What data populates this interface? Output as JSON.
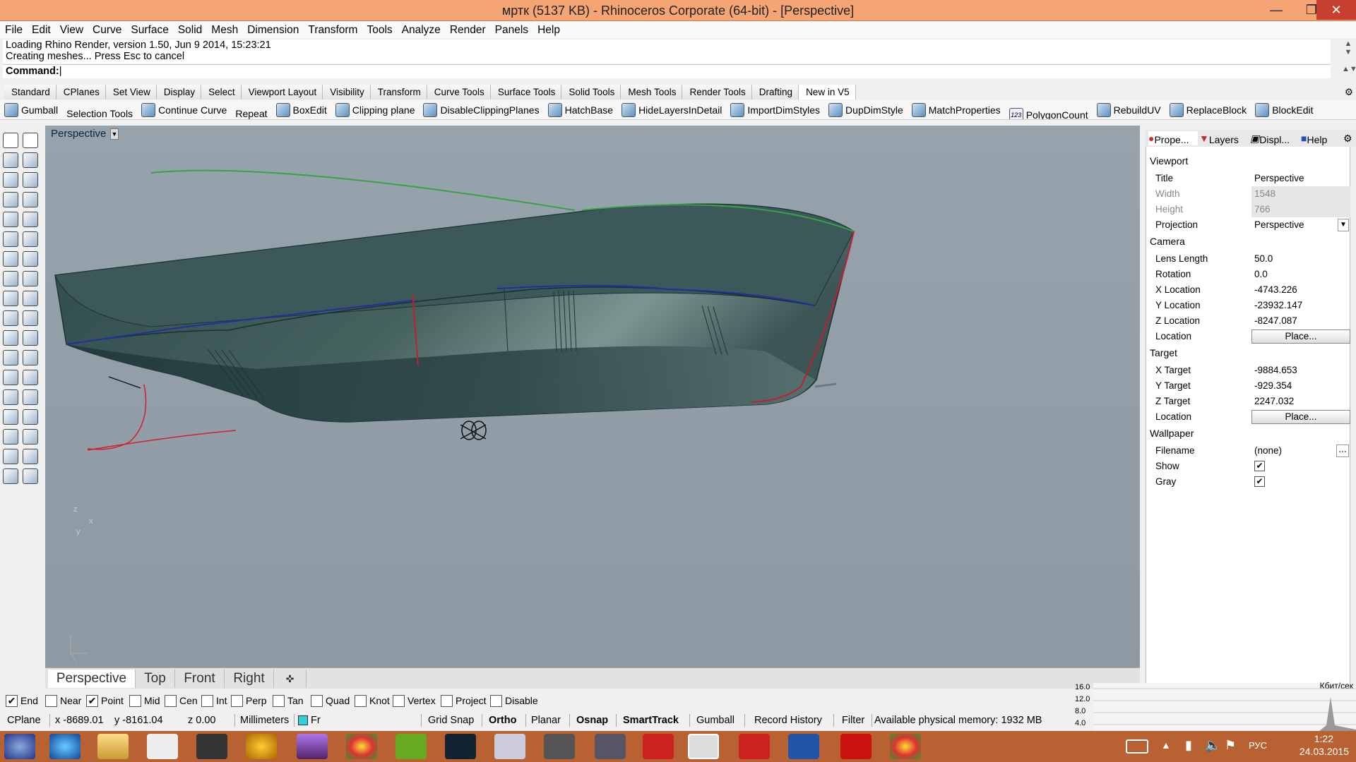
{
  "window": {
    "title": "мртк (5137 KB) - Rhinoceros Corporate (64-bit) - [Perspective]"
  },
  "menu": [
    "File",
    "Edit",
    "View",
    "Curve",
    "Surface",
    "Solid",
    "Mesh",
    "Dimension",
    "Transform",
    "Tools",
    "Analyze",
    "Render",
    "Panels",
    "Help"
  ],
  "command": {
    "history": [
      "Loading Rhino Render, version 1.50, Jun  9 2014, 15:23:21",
      "Creating meshes... Press Esc to cancel"
    ],
    "prompt": "Command:"
  },
  "tool_tabs": [
    "Standard",
    "CPlanes",
    "Set View",
    "Display",
    "Select",
    "Viewport Layout",
    "Visibility",
    "Transform",
    "Curve Tools",
    "Surface Tools",
    "Solid Tools",
    "Mesh Tools",
    "Render Tools",
    "Drafting",
    "New in V5"
  ],
  "toolbar": [
    "Gumball",
    "Selection Tools",
    "Continue Curve",
    "Repeat",
    "BoxEdit",
    "Clipping plane",
    "DisableClippingPlanes",
    "HatchBase",
    "HideLayersInDetail",
    "ImportDimStyles",
    "DupDimStyle",
    "MatchProperties",
    "PolygonCount",
    "RebuildUV",
    "ReplaceBlock",
    "BlockEdit"
  ],
  "polygon_count_icon_text": "123",
  "viewport": {
    "title": "Perspective",
    "axis_z": "z",
    "axis_y": "y",
    "axis_x": "x"
  },
  "view_tabs": [
    "Perspective",
    "Top",
    "Front",
    "Right"
  ],
  "osnap": [
    {
      "label": "End",
      "checked": true
    },
    {
      "label": "Near",
      "checked": false
    },
    {
      "label": "Point",
      "checked": true
    },
    {
      "label": "Mid",
      "checked": false
    },
    {
      "label": "Cen",
      "checked": false
    },
    {
      "label": "Int",
      "checked": false
    },
    {
      "label": "Perp",
      "checked": false
    },
    {
      "label": "Tan",
      "checked": false
    },
    {
      "label": "Quad",
      "checked": false
    },
    {
      "label": "Knot",
      "checked": false
    },
    {
      "label": "Vertex",
      "checked": false
    },
    {
      "label": "Project",
      "checked": false
    },
    {
      "label": "Disable",
      "checked": false
    }
  ],
  "status": {
    "cplane": "CPlane",
    "x": "x -8689.01",
    "y": "y -8161.04",
    "z": "z 0.00",
    "units": "Millimeters",
    "layer": "Fr",
    "grid_snap": "Grid Snap",
    "ortho": "Ortho",
    "planar": "Planar",
    "osnap": "Osnap",
    "smarttrack": "SmartTrack",
    "gumball": "Gumball",
    "record_history": "Record History",
    "filter": "Filter",
    "memory": "Available physical memory: 1932 MB"
  },
  "panel": {
    "tabs": [
      "Prope...",
      "Layers",
      "Displ...",
      "Help"
    ],
    "viewport_header": "Viewport",
    "viewport": [
      {
        "label": "Title",
        "value": "Perspective"
      },
      {
        "label": "Width",
        "value": "1548"
      },
      {
        "label": "Height",
        "value": "766"
      },
      {
        "label": "Projection",
        "value": "Perspective"
      }
    ],
    "camera_header": "Camera",
    "camera": [
      {
        "label": "Lens Length",
        "value": "50.0"
      },
      {
        "label": "Rotation",
        "value": "0.0"
      },
      {
        "label": "X Location",
        "value": "-4743.226"
      },
      {
        "label": "Y Location",
        "value": "-23932.147"
      },
      {
        "label": "Z Location",
        "value": "-8247.087"
      },
      {
        "label": "Location",
        "value": "Place..."
      }
    ],
    "target_header": "Target",
    "target": [
      {
        "label": "X Target",
        "value": "-9884.653"
      },
      {
        "label": "Y Target",
        "value": "-929.354"
      },
      {
        "label": "Z Target",
        "value": "2247.032"
      },
      {
        "label": "Location",
        "value": "Place..."
      }
    ],
    "wallpaper_header": "Wallpaper",
    "wallpaper": [
      {
        "label": "Filename",
        "value": "(none)"
      },
      {
        "label": "Show",
        "value": "✔"
      },
      {
        "label": "Gray",
        "value": "✔"
      }
    ],
    "browse": "..."
  },
  "network": {
    "unit": "Кбит/сек",
    "ticks": [
      "16.0",
      "12.0",
      "8.0",
      "4.0"
    ]
  },
  "tray": {
    "lang": "РУС",
    "time": "1:22",
    "date": "24.03.2015"
  },
  "colors": {
    "titlebar": "#f5a573",
    "taskbar": "#b86234",
    "viewport": "#939fa8",
    "hull": "#3e5a5a"
  }
}
